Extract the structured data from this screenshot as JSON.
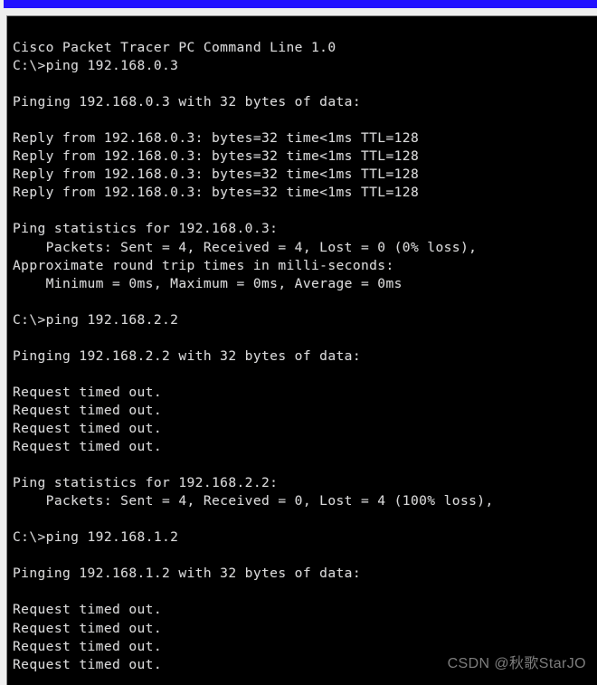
{
  "window": {
    "title_bar_color": "#2211ff",
    "background_color": "#efefef"
  },
  "terminal": {
    "background_color": "#000000",
    "text_color": "#d9d9d9",
    "header": "Cisco Packet Tracer PC Command Line 1.0",
    "prompt": "C:\\>",
    "lines": [
      "Cisco Packet Tracer PC Command Line 1.0",
      "C:\\>ping 192.168.0.3",
      "",
      "Pinging 192.168.0.3 with 32 bytes of data:",
      "",
      "Reply from 192.168.0.3: bytes=32 time<1ms TTL=128",
      "Reply from 192.168.0.3: bytes=32 time<1ms TTL=128",
      "Reply from 192.168.0.3: bytes=32 time<1ms TTL=128",
      "Reply from 192.168.0.3: bytes=32 time<1ms TTL=128",
      "",
      "Ping statistics for 192.168.0.3:",
      "    Packets: Sent = 4, Received = 4, Lost = 0 (0% loss),",
      "Approximate round trip times in milli-seconds:",
      "    Minimum = 0ms, Maximum = 0ms, Average = 0ms",
      "",
      "C:\\>ping 192.168.2.2",
      "",
      "Pinging 192.168.2.2 with 32 bytes of data:",
      "",
      "Request timed out.",
      "Request timed out.",
      "Request timed out.",
      "Request timed out.",
      "",
      "Ping statistics for 192.168.2.2:",
      "    Packets: Sent = 4, Received = 0, Lost = 4 (100% loss),",
      "",
      "C:\\>ping 192.168.1.2",
      "",
      "Pinging 192.168.1.2 with 32 bytes of data:",
      "",
      "Request timed out.",
      "Request timed out.",
      "Request timed out.",
      "Request timed out."
    ],
    "sessions": [
      {
        "command": "ping 192.168.0.3",
        "target": "192.168.0.3",
        "bytes": 32,
        "replies": 4,
        "sent": 4,
        "received": 4,
        "lost": 0,
        "loss_percent": "0%",
        "ttl": 128,
        "time": "<1ms",
        "minimum": "0ms",
        "maximum": "0ms",
        "average": "0ms",
        "result": "success"
      },
      {
        "command": "ping 192.168.2.2",
        "target": "192.168.2.2",
        "bytes": 32,
        "replies": 0,
        "sent": 4,
        "received": 0,
        "lost": 4,
        "loss_percent": "100%",
        "result": "timed out"
      },
      {
        "command": "ping 192.168.1.2",
        "target": "192.168.1.2",
        "bytes": 32,
        "replies": 0,
        "result": "timed out"
      }
    ]
  },
  "watermark": {
    "text": "CSDN @秋歌StarJO",
    "color": "#8e8e8e"
  }
}
